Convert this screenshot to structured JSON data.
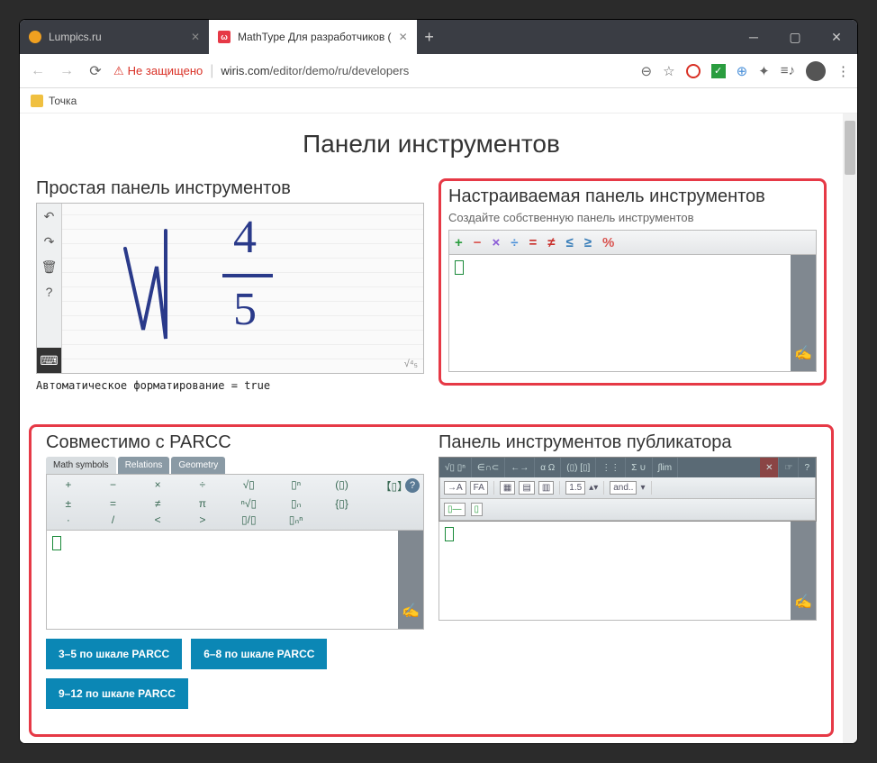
{
  "window": {
    "tab1": "Lumpics.ru",
    "tab2": "MathType Для разработчиков (",
    "tab2_fav": "ω"
  },
  "address": {
    "secure": "Не защищено",
    "domain": "wiris.com",
    "path": "/editor/demo/ru/developers"
  },
  "bookmark": {
    "label": "Точка"
  },
  "page": {
    "title": "Панели инструментов",
    "simple": {
      "heading": "Простая панель инструментов",
      "footnote": "Автоматическое форматирование = true",
      "frac_top": "4",
      "frac_bot": "5",
      "corner": "√⁴₅"
    },
    "custom": {
      "heading": "Настраиваемая панель инструментов",
      "sub": "Создайте собственную панель инструментов",
      "ops": [
        "+",
        "−",
        "×",
        "÷",
        "=",
        "≠",
        "≤",
        "≥",
        "%"
      ]
    },
    "parcc": {
      "heading": "Совместимо с PARCC",
      "tabs": [
        "Math symbols",
        "Relations",
        "Geometry"
      ],
      "btns": [
        "3–5 по шкале PARCC",
        "6–8 по шкале PARCC",
        "9–12 по шкале PARCC"
      ]
    },
    "publisher": {
      "heading": "Панель инструментов публикатора",
      "tabs": [
        "√▯ ▯ⁿ",
        "∈∩⊂",
        "←→",
        "α Ω",
        "(▯) [▯]",
        "⋮⋮",
        "Σ ∪",
        "∫lim",
        "✕",
        "☞",
        "?"
      ],
      "sub": {
        "size": "1.5",
        "text": "and.."
      }
    }
  },
  "colors": {
    "red": "#e63946",
    "op": [
      "#2a9d3f",
      "#d9534f",
      "#8a5ad6",
      "#4a90d9",
      "#c9302c",
      "#c9302c",
      "#337ab7",
      "#337ab7",
      "#d9534f"
    ]
  }
}
